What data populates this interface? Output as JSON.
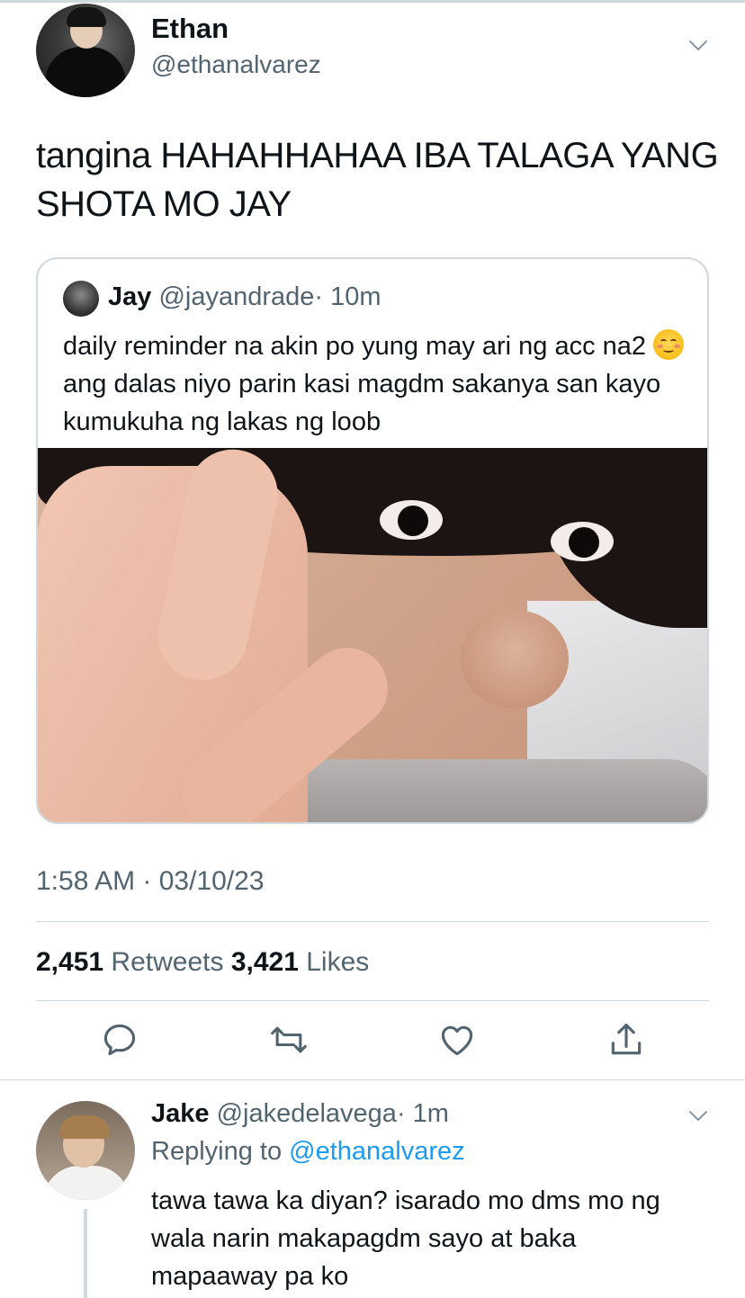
{
  "main_tweet": {
    "display_name": "Ethan",
    "handle": "@ethanalvarez",
    "text": "tangina HAHAHHAHAA IBA TALAGA YANG SHOTA MO JAY",
    "timestamp": "1:58 AM · 03/10/23",
    "retweets_count": "2,451",
    "retweets_label": "Retweets",
    "likes_count": "3,421",
    "likes_label": "Likes"
  },
  "quoted_tweet": {
    "display_name": "Jay",
    "handle": "@jayandrade",
    "time_ago": "· 10m",
    "text_part1": "daily reminder na akin po yung may ari ng acc na2",
    "emoji": "smiling-face-with-blush",
    "text_part2": "ang dalas niyo parin kasi magdm sakanya san kayo kumukuha ng lakas ng loob"
  },
  "reply": {
    "display_name": "Jake",
    "handle": "@jakedelavega",
    "time_ago": "· 1m",
    "replying_prefix": "Replying to",
    "replying_to": "@ethanalvarez",
    "text": "tawa tawa ka diyan? isarado mo dms mo ng wala narin makapagdm sayo at baka mapaaway pa ko"
  },
  "actions": [
    "reply-icon",
    "retweet-icon",
    "like-icon",
    "share-icon"
  ],
  "colors": {
    "text_primary": "#0f1419",
    "text_secondary": "#536471",
    "link": "#1d9bf0",
    "border": "#cfd9de"
  }
}
